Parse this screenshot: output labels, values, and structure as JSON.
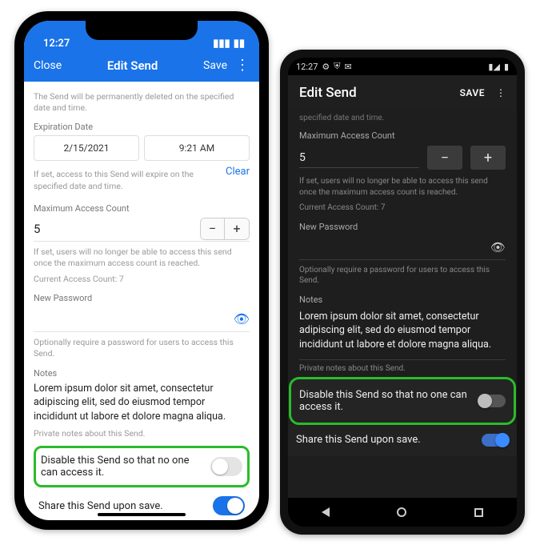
{
  "ios": {
    "status": {
      "time": "12:27"
    },
    "nav": {
      "close": "Close",
      "title": "Edit Send",
      "save": "Save"
    },
    "deletion_helper": "The Send will be permanently deleted on the specified date and time.",
    "expiration": {
      "label": "Expiration Date",
      "date": "2/15/2021",
      "time": "9:21 AM",
      "helper": "If set, access to this Send will expire on the specified date and time.",
      "clear": "Clear"
    },
    "max_access": {
      "label": "Maximum Access Count",
      "value": "5",
      "helper": "If set, users will no longer be able to access this send once the maximum access count is reached.",
      "current_label": "Current Access Count:",
      "current_value": "7"
    },
    "password": {
      "label": "New Password",
      "helper": "Optionally require a password for users to access this Send."
    },
    "notes": {
      "label": "Notes",
      "text": "Lorem ipsum dolor sit amet, consectetur adipiscing elit, sed do eiusmod tempor incididunt ut labore et dolore magna aliqua.",
      "helper": "Private notes about this Send."
    },
    "disable_label": "Disable this Send so that no one can access it.",
    "share_label": "Share this Send upon save."
  },
  "android": {
    "status": {
      "time": "12:27"
    },
    "appbar": {
      "title": "Edit Send",
      "save": "SAVE"
    },
    "cut_helper": "specified date and time.",
    "max_access": {
      "label": "Maximum Access Count",
      "value": "5",
      "helper": "If set, users will no longer be able to access this send once the maximum access count is reached.",
      "current_label": "Current Access Count:",
      "current_value": "7"
    },
    "password": {
      "label": "New Password",
      "helper": "Optionally require a password for users to access this Send."
    },
    "notes": {
      "label": "Notes",
      "text": "Lorem ipsum dolor sit amet, consectetur adipiscing elit, sed do eiusmod tempor incididunt ut labore et dolore magna aliqua.",
      "helper": "Private notes about this Send."
    },
    "disable_label": "Disable this Send so that no one can access it.",
    "share_label": "Share this Send upon save."
  }
}
